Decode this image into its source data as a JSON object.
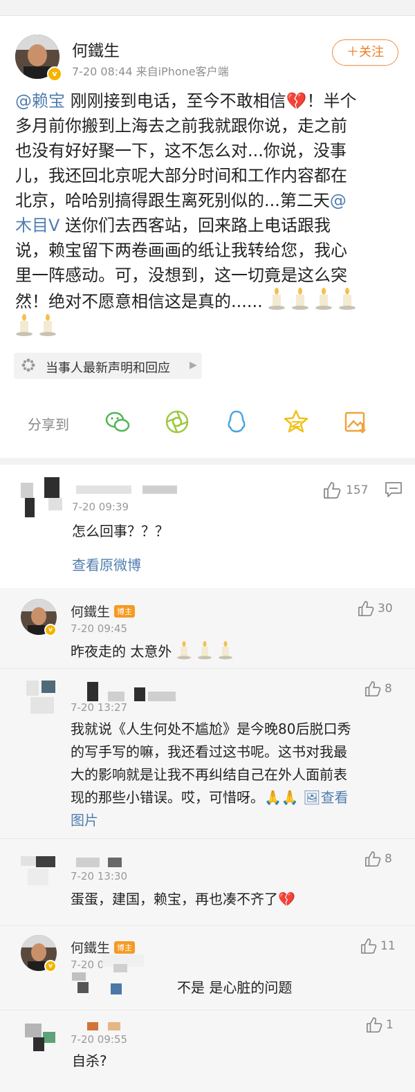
{
  "post": {
    "author_name": "何鐵生",
    "meta": "7-20 08:44  来自iPhone客户端",
    "follow_label": "＋关注",
    "mention_1": "@赖宝",
    "body_lines": [
      " 刚刚接到电话，至今不敢相信",
      "多月前你搬到上海去之前我就跟你说，走之前",
      "也没有好好聚一下，这不怎么对...你说，没事",
      "儿，我还回北京呢大部分时间和工作内容都在",
      "北京，哈哈别搞得跟生离死别似的...第二天",
      "木目V",
      " 送你们去西客站，回来路上电话跟我",
      "说，赖宝留下两卷画画的纸让我转给您，我心",
      "里一阵感动。可，没想到，这一切竟是这么突",
      "然！绝对不愿意相信这是真的......"
    ],
    "line1_suffix": "！半个",
    "mention_2": "@",
    "topic_label": "当事人最新声明和回应",
    "share_label": "分享到",
    "share_icons": [
      "wechat-icon",
      "moments-icon",
      "qq-icon",
      "qzone-icon",
      "save-image-icon"
    ]
  },
  "comments": [
    {
      "time": "7-20 09:39",
      "text": "怎么回事？？？",
      "likes": "157",
      "link": "查看原微博"
    }
  ],
  "replies": [
    {
      "name": "何鐵生",
      "badge": "博主",
      "time": "7-20 09:45",
      "text": "昨夜走的 太意外",
      "likes": "30"
    },
    {
      "time": "7-20 13:27",
      "likes": "8",
      "lines": [
        "我就说《人生何处不尴尬》是今晚80后脱口秀",
        "的写手写的嘛，我还看过这书呢。这书对我最",
        "大的影响就是让我不再纠结自己在外人面前表",
        "现的那些小错误。哎，可惜呀。"
      ],
      "view_label": "查看",
      "view_label2": "图片"
    },
    {
      "time": "7-20 13:30",
      "text": "蛋蛋，建国，赖宝，再也凑不齐了",
      "likes": "8"
    },
    {
      "name": "何鐵生",
      "badge": "博主",
      "time": "7-20 0",
      "text": "不是 是心脏的问题",
      "likes": "11"
    },
    {
      "time": "7-20 09:55",
      "text": "自杀?",
      "likes": "1"
    }
  ],
  "colors": {
    "link": "#507daf",
    "follow": "#ef7d26",
    "badge": "#f59a23"
  }
}
